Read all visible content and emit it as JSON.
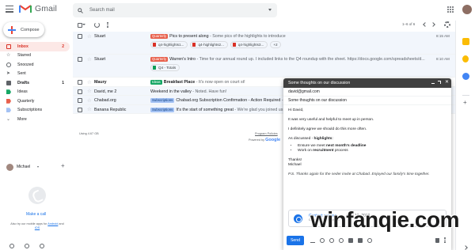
{
  "header": {
    "logo_text": "Gmail",
    "search_placeholder": "Search mail"
  },
  "toolbar": {
    "pagination": "1–6 of 6"
  },
  "sidebar": {
    "compose_label": "Compose",
    "items": [
      {
        "label": "Inbox",
        "count": "2",
        "icon": "inbox-icon"
      },
      {
        "label": "Starred",
        "count": "",
        "icon": "star-icon"
      },
      {
        "label": "Snoozed",
        "count": "",
        "icon": "clock-icon"
      },
      {
        "label": "Sent",
        "count": "",
        "icon": "send-icon"
      },
      {
        "label": "Drafts",
        "count": "1",
        "icon": "draft-icon"
      },
      {
        "label": "Ideas",
        "count": "",
        "icon": "label-icon"
      },
      {
        "label": "Quarterly",
        "count": "",
        "icon": "label-icon"
      },
      {
        "label": "Subscriptions",
        "count": "",
        "icon": "label-icon"
      },
      {
        "label": "More",
        "count": "",
        "icon": "chevron-down-icon"
      }
    ],
    "hangouts": {
      "user_name": "Michael",
      "make_call": "Make a call",
      "app_hint_pre": "Also try our mobile apps for ",
      "android": "Android",
      "and": " and ",
      "ios": "iOS"
    }
  },
  "emails": [
    {
      "sender": "Stuart",
      "label": "Quarterly",
      "subject": "Pics to present along",
      "snippet": " - Some pics of the highlights to introduce",
      "time": "8:15 AM",
      "unread": false,
      "attachments": [
        "q4-highlights1...",
        "q4-highlights2...",
        "q4-highlights3..."
      ],
      "more": "+2"
    },
    {
      "sender": "Stuart",
      "label": "Quarterly",
      "subject": "Warren's Intro",
      "snippet": " - Time for our annual round up. I included links to the Q4 roundup with the sheet. https://docs.google.com/spreadsheets/d...",
      "time": "8:10 AM",
      "unread": false,
      "attachments": [
        "Q4 - Totals"
      ]
    },
    {
      "sender": "Maury",
      "label": "Ideas",
      "subject": "Breakfast Place",
      "snippet": " - It's now open on court st!",
      "time": "",
      "unread": true
    },
    {
      "sender": "David, me 2",
      "label": "",
      "subject": "Weekend in the valley",
      "snippet": " - Noted. Have fun!",
      "time": "",
      "unread": false
    },
    {
      "sender": "Chabad.org",
      "label": "Subscriptions",
      "subject": "Chabad.org Subscription Confirmation - Action Required",
      "snippet": " - Ple",
      "time": "",
      "unread": false
    },
    {
      "sender": "Banana Republic",
      "label": "Subscriptions",
      "subject": "It's the start of something great",
      "snippet": " - We're glad you joined us",
      "time": "",
      "unread": false
    }
  ],
  "footer": {
    "storage": "Using 4.67 GB",
    "policy": "Program Policies",
    "powered_pre": "Powered by ",
    "powered_brand": "Google"
  },
  "compose_window": {
    "title": "Some thoughts on our discussion",
    "to": "david@gmail.com",
    "subject": "Some thoughts on our discussion",
    "greeting": "Hi David,",
    "p1": "It was very useful and helpful to meet up in person.",
    "p2": "I definitely agree we should do this more often.",
    "p3_pre": "As discussed - ",
    "p3_bold": "highlights",
    "p3_post": ":",
    "bullet1_pre": "Ensure we meet ",
    "bullet1_bold": "next month's deadline",
    "bullet2_pre": "Work on ",
    "bullet2_bold": "recruitment",
    "bullet2_post": " process",
    "thanks": "Thanks!",
    "signature": "Michael",
    "ps": "P.S. Thanks again for the seder invite at Chabad. Enjoyed our family's time together.",
    "confidential_title": "Content expires",
    "confidential_date": "Mar 13, 2018",
    "confidential_sub": "Options ... and attach...",
    "send_label": "Send"
  },
  "watermark": "winfanqie.com",
  "colors": {
    "accent": "#1a73e8",
    "inbox_active": "#d93025",
    "quarterly_label": "#e8604c",
    "ideas_label": "#16a765",
    "subscriptions_label": "#a4c2f4"
  }
}
